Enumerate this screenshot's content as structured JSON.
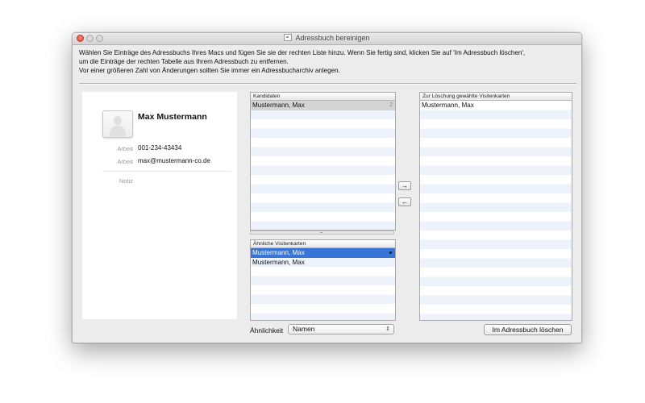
{
  "window": {
    "title": "Adressbuch bereinigen",
    "instructions": [
      "Wählen Sie Einträge des Adressbuchs Ihres Macs und fügen Sie sie der rechten Liste hinzu. Wenn Sie fertig sind, klicken Sie auf 'Im Adressbuch löschen',",
      "um die Einträge der rechten Tabelle aus Ihrem Adressbuch zu entfernen.",
      "Vor einer größeren Zahl von Änderungen sollten Sie immer ein Adressbucharchiv anlegen."
    ]
  },
  "contact": {
    "name": "Max Mustermann",
    "phone_label": "Arbeit",
    "phone": "001-234-43434",
    "email_label": "Arbeit",
    "email": "max@mustermann-co.de",
    "note_label": "Notiz"
  },
  "candidates": {
    "header": "Kandidaten",
    "rows": [
      {
        "name": "Mustermann, Max",
        "count": "2"
      }
    ]
  },
  "similar": {
    "header": "Ähnliche Visitenkarten",
    "rows": [
      {
        "name": "Mustermann, Max"
      },
      {
        "name": "Mustermann, Max"
      }
    ]
  },
  "deletion": {
    "header": "Zur Löschung gewählte Visitenkarten",
    "rows": [
      {
        "name": "Mustermann, Max"
      }
    ]
  },
  "buttons": {
    "add": "→",
    "remove": "←",
    "delete": "Im Adressbuch löschen"
  },
  "similarity": {
    "label": "Ähnlichkeit",
    "selected": "Namen",
    "chevron": "⇕"
  },
  "colors": {
    "selection_blue": "#3875d7",
    "close_red": "#e0443a",
    "stripe": "#eef3fb"
  }
}
